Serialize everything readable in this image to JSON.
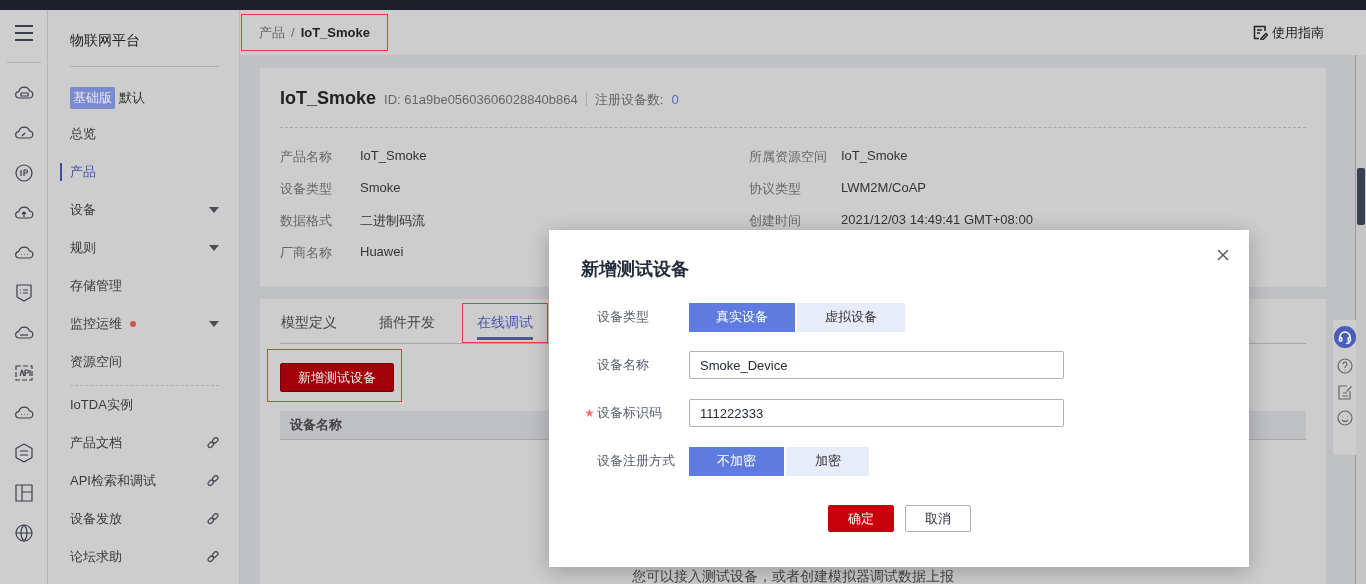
{
  "sidebar": {
    "title": "物联网平台",
    "edition": {
      "badge": "基础版",
      "label": "默认"
    },
    "items": [
      {
        "label": "总览",
        "kind": "plain",
        "selected": false,
        "notice": false
      },
      {
        "label": "产品",
        "kind": "plain",
        "selected": true,
        "notice": false
      },
      {
        "label": "设备",
        "kind": "menu",
        "selected": false,
        "notice": false
      },
      {
        "label": "规则",
        "kind": "menu",
        "selected": false,
        "notice": false
      },
      {
        "label": "存储管理",
        "kind": "plain",
        "selected": false,
        "notice": false
      },
      {
        "label": "监控运维",
        "kind": "menu",
        "selected": false,
        "notice": true
      },
      {
        "label": "资源空间",
        "kind": "plain",
        "selected": false,
        "notice": false
      }
    ],
    "links": [
      {
        "label": "IoTDA实例",
        "kind": "plain"
      },
      {
        "label": "产品文档",
        "kind": "link"
      },
      {
        "label": "API检索和调试",
        "kind": "link"
      },
      {
        "label": "设备发放",
        "kind": "link"
      },
      {
        "label": "论坛求助",
        "kind": "link"
      }
    ]
  },
  "breadcrumb": {
    "parent": "产品",
    "separator": "/",
    "current": "IoT_Smoke",
    "highlighted": true
  },
  "guide_link": "使用指南",
  "product": {
    "name": "IoT_Smoke",
    "id": "ID: 61a9be05603606028840b864",
    "registered_label": "注册设备数:",
    "registered_count": "0",
    "left_fields": [
      {
        "label": "产品名称",
        "value": "IoT_Smoke"
      },
      {
        "label": "设备类型",
        "value": "Smoke"
      },
      {
        "label": "数据格式",
        "value": "二进制码流"
      },
      {
        "label": "厂商名称",
        "value": "Huawei"
      }
    ],
    "right_fields": [
      {
        "label": "所属资源空间",
        "value": "IoT_Smoke"
      },
      {
        "label": "协议类型",
        "value": "LWM2M/CoAP"
      },
      {
        "label": "创建时间",
        "value": "2021/12/03 14:49:41 GMT+08:00"
      }
    ]
  },
  "tabs": [
    {
      "label": "模型定义",
      "selected": false,
      "highlighted": false
    },
    {
      "label": "插件开发",
      "selected": false,
      "highlighted": false
    },
    {
      "label": "在线调试",
      "selected": true,
      "highlighted": true
    }
  ],
  "add_button": {
    "label": "新增测试设备",
    "highlighted": true
  },
  "table": {
    "columns": [
      "设备名称"
    ]
  },
  "empty_hint": "您可以接入测试设备，或者创建模拟器调试数据上报",
  "dialog": {
    "title": "新增测试设备",
    "fields": [
      {
        "kind": "toggle",
        "label": "设备类型",
        "required": false,
        "options": [
          {
            "label": "真实设备",
            "selected": true
          },
          {
            "label": "虚拟设备",
            "selected": false
          }
        ]
      },
      {
        "kind": "input",
        "label": "设备名称",
        "required": false,
        "value": "Smoke_Device"
      },
      {
        "kind": "input",
        "label": "设备标识码",
        "required": true,
        "value": "111222333"
      },
      {
        "kind": "toggle",
        "label": "设备注册方式",
        "required": false,
        "options": [
          {
            "label": "不加密",
            "selected": true
          },
          {
            "label": "加密",
            "selected": false
          }
        ]
      }
    ],
    "buttons": [
      {
        "label": "确定",
        "kind": "primary"
      },
      {
        "label": "取消",
        "kind": "secondary"
      }
    ]
  }
}
